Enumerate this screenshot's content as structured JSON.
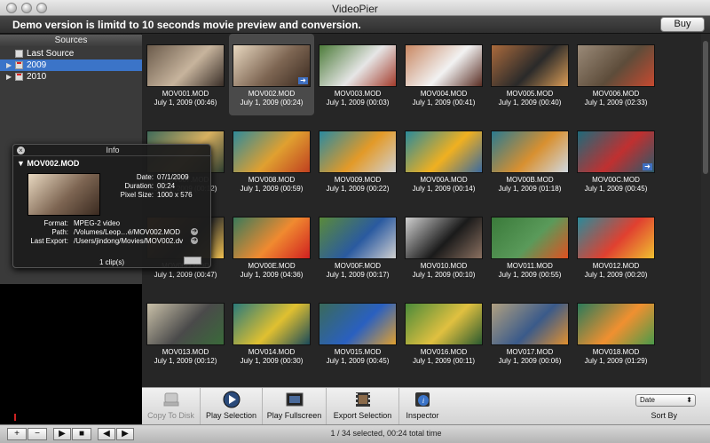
{
  "window": {
    "title": "VideoPier"
  },
  "demo_banner": {
    "text": "Demo version is limitd to 10 seconds movie preview and conversion.",
    "buy_label": "Buy"
  },
  "sidebar": {
    "header": "Sources",
    "items": [
      {
        "label": "Last Source",
        "icon": "film-icon"
      },
      {
        "label": "2009",
        "icon": "calendar-icon",
        "selected": true
      },
      {
        "label": "2010",
        "icon": "calendar-icon"
      }
    ]
  },
  "clips": [
    {
      "name": "MOV001.MOD",
      "date": "July 1, 2009 (00:46)",
      "colors": [
        "#6b5b4b",
        "#c7b49d",
        "#3a2f28"
      ]
    },
    {
      "name": "MOV002.MOD",
      "date": "July 1, 2009 (00:24)",
      "colors": [
        "#e8d8c0",
        "#7d6552",
        "#3a2a20"
      ],
      "selected": true,
      "badge": true
    },
    {
      "name": "MOV003.MOD",
      "date": "July 1, 2009 (00:03)",
      "colors": [
        "#4d7c3a",
        "#e6e6e6",
        "#a33b2b"
      ]
    },
    {
      "name": "MOV004.MOD",
      "date": "July 1, 2009 (00:41)",
      "colors": [
        "#c98863",
        "#f2f2f2",
        "#5a2e24"
      ]
    },
    {
      "name": "MOV005.MOD",
      "date": "July 1, 2009 (00:40)",
      "colors": [
        "#aa6a3c",
        "#2a2a2a",
        "#d99b55"
      ]
    },
    {
      "name": "MOV006.MOD",
      "date": "July 1, 2009 (02:33)",
      "colors": [
        "#9a8a78",
        "#5d4c3a",
        "#c74a30"
      ]
    },
    {
      "name": "MOV007.MOD",
      "date": "July 1, 2009 (00:12)",
      "colors": [
        "#3f6a5a",
        "#d8b060",
        "#2e3e30"
      ]
    },
    {
      "name": "MOV008.MOD",
      "date": "July 1, 2009 (00:59)",
      "colors": [
        "#2f8a9a",
        "#e0a030",
        "#c04020"
      ]
    },
    {
      "name": "MOV009.MOD",
      "date": "July 1, 2009 (00:22)",
      "colors": [
        "#2a8aa0",
        "#e39a28",
        "#d0d0d0"
      ]
    },
    {
      "name": "MOV00A.MOD",
      "date": "July 1, 2009 (00:14)",
      "colors": [
        "#2a8a9a",
        "#f0b020",
        "#3a6aa0"
      ]
    },
    {
      "name": "MOV00B.MOD",
      "date": "July 1, 2009 (01:18)",
      "colors": [
        "#2a7a90",
        "#d89030",
        "#d0d8e0"
      ]
    },
    {
      "name": "MOV00C.MOD",
      "date": "July 1, 2009 (00:45)",
      "colors": [
        "#1e6a7a",
        "#c03030",
        "#2a5a6a"
      ],
      "badge": true
    },
    {
      "name": "MOV00D.MOD",
      "date": "July 1, 2009 (00:47)",
      "colors": [
        "#e08030",
        "#2a2a2a",
        "#f0c050"
      ]
    },
    {
      "name": "MOV00E.MOD",
      "date": "July 1, 2009 (04:36)",
      "colors": [
        "#3a7a5a",
        "#f08a30",
        "#d02020"
      ]
    },
    {
      "name": "MOV00F.MOD",
      "date": "July 1, 2009 (00:17)",
      "colors": [
        "#5a8a3a",
        "#2a5aa0",
        "#d0d0d0"
      ]
    },
    {
      "name": "MOV010.MOD",
      "date": "July 1, 2009 (00:10)",
      "colors": [
        "#d0d0d0",
        "#1a1a1a",
        "#8a7060"
      ]
    },
    {
      "name": "MOV011.MOD",
      "date": "July 1, 2009 (00:55)",
      "colors": [
        "#3a7a3a",
        "#5a9a5a",
        "#e05020"
      ]
    },
    {
      "name": "MOV012.MOD",
      "date": "July 1, 2009 (00:20)",
      "colors": [
        "#2a8a9a",
        "#e04030",
        "#f0c030"
      ]
    },
    {
      "name": "MOV013.MOD",
      "date": "July 1, 2009 (00:12)",
      "colors": [
        "#c9c0a8",
        "#4a4a4a",
        "#3a6a3a"
      ]
    },
    {
      "name": "MOV014.MOD",
      "date": "July 1, 2009 (00:30)",
      "colors": [
        "#2a7a7a",
        "#e0c030",
        "#1a4a5a"
      ]
    },
    {
      "name": "MOV015.MOD",
      "date": "July 1, 2009 (00:45)",
      "colors": [
        "#3a6a5a",
        "#2a60c0",
        "#e0a030"
      ]
    },
    {
      "name": "MOV016.MOD",
      "date": "July 1, 2009 (00:11)",
      "colors": [
        "#4a8a3a",
        "#e0c040",
        "#2a5a30"
      ]
    },
    {
      "name": "MOV017.MOD",
      "date": "July 1, 2009 (00:06)",
      "colors": [
        "#b0a080",
        "#3a5a8a",
        "#e09030"
      ]
    },
    {
      "name": "MOV018.MOD",
      "date": "July 1, 2009 (01:29)",
      "colors": [
        "#2a7a5a",
        "#f09030",
        "#4a9a4a"
      ]
    }
  ],
  "info_panel": {
    "title": "Info",
    "file": "▼ MOV002.MOD",
    "date_label": "Date:",
    "date": "07/1/2009",
    "duration_label": "Duration:",
    "duration": "00:24",
    "pixel_label": "Pixel Size:",
    "pixel_size": "1000 x 576",
    "format_label": "Format:",
    "format": "MPEG-2 video",
    "path_label": "Path:",
    "path": "/Volumes/Leop…é/MOV002.MOD",
    "export_label": "Last Export:",
    "last_export": "/Users/jindong/Movies/MOV002.dv",
    "clips": "1 clip(s)"
  },
  "toolbar": {
    "copy_label": "Copy To Disk",
    "play_label": "Play Selection",
    "fullscreen_label": "Play Fullscreen",
    "export_label": "Export Selection",
    "inspector_label": "Inspector",
    "sort_value": "Date",
    "sort_label": "Sort By"
  },
  "status": {
    "text": "1 / 34 selected, 00:24 total time"
  },
  "colors": {
    "accent": "#3b74c8",
    "background": "#262626"
  }
}
